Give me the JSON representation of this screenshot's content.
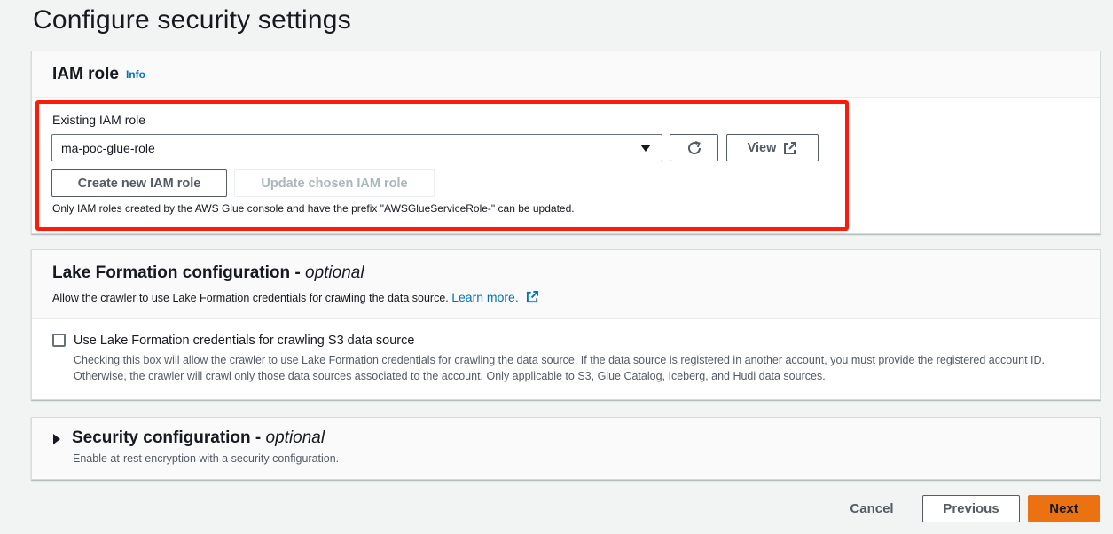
{
  "page": {
    "title": "Configure security settings"
  },
  "iam": {
    "title": "IAM role",
    "info": "Info",
    "field_label": "Existing IAM role",
    "selected_role": "ma-poc-glue-role",
    "view_label": "View",
    "create_label": "Create new IAM role",
    "update_label": "Update chosen IAM role",
    "hint": "Only IAM roles created by the AWS Glue console and have the prefix \"AWSGlueServiceRole-\" can be updated."
  },
  "lake_formation": {
    "title": "Lake Formation configuration - ",
    "optional": "optional",
    "description": "Allow the crawler to use Lake Formation credentials for crawling the data source.",
    "learn_more": "Learn more.",
    "checkbox_label": "Use Lake Formation credentials for crawling S3 data source",
    "checkbox_checked": false,
    "checkbox_description": "Checking this box will allow the crawler to use Lake Formation credentials for crawling the data source. If the data source is registered in another account, you must provide the registered account ID. Otherwise, the crawler will crawl only those data sources associated to the account. Only applicable to S3, Glue Catalog, Iceberg, and Hudi data sources."
  },
  "security_config": {
    "title": "Security configuration - ",
    "optional": "optional",
    "description": "Enable at-rest encryption with a security configuration."
  },
  "footer": {
    "cancel_label": "Cancel",
    "previous_label": "Previous",
    "next_label": "Next"
  },
  "colors": {
    "accent_link": "#0073bb",
    "primary_button": "#ec7211",
    "highlight": "#ff1a0a",
    "background": "#f2f3f3"
  }
}
